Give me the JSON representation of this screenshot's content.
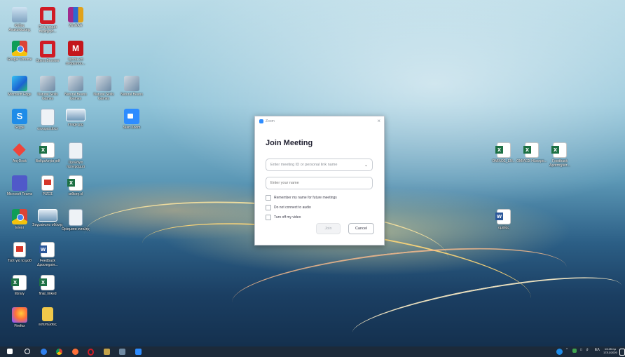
{
  "desktop": {
    "icons": [
      {
        "label": "Κάδος Ανακύκλωσης",
        "icon": "recycle-bin-icon"
      },
      {
        "label": "Πρόγραμμα περιήγησ...",
        "icon": "opera-icon"
      },
      {
        "label": "WinRAR",
        "icon": "winrar-icon"
      },
      {
        "label": "Google Chrome",
        "icon": "chrome-icon"
      },
      {
        "label": "Opera Browser",
        "icon": "opera-icon"
      },
      {
        "label": "Ιstoria και ανθρώπου...",
        "icon": "mcgraw-icon"
      },
      {
        "label": "Microsoft Edge",
        "icon": "edge-icon"
      },
      {
        "label": "Natural Skills Games",
        "icon": "boat-icon"
      },
      {
        "label": "Natural Beans Games",
        "icon": "boat-icon"
      },
      {
        "label": "Natural Skills Games",
        "icon": "boat-icon"
      },
      {
        "label": "Natural Beans",
        "icon": "boat-icon"
      },
      {
        "label": "Skype",
        "icon": "skype-icon"
      },
      {
        "label": "σεναρια.docx",
        "icon": "document-icon"
      },
      {
        "label": "image.jpg",
        "icon": "image-icon"
      },
      {
        "label": "Start Zoom",
        "icon": "zoom-icon"
      },
      {
        "label": "AnyDesk",
        "icon": "anydesk-icon"
      },
      {
        "label": "Βαθμολογία pdf",
        "icon": "excel-icon"
      },
      {
        "label": "Ωρολόγιο πρόγραμμα",
        "icon": "document-icon"
      },
      {
        "label": "Microsoft Teams",
        "icon": "teams-icon"
      },
      {
        "label": "ΡΙΖΟΣ",
        "icon": "pdf-icon"
      },
      {
        "label": "εκθεση.xl",
        "icon": "excel-icon"
      },
      {
        "label": "Ereni",
        "icon": "chrome-icon"
      },
      {
        "label": "Στιγμιότυπο οθόνης",
        "icon": "image-icon"
      },
      {
        "label": "Ορίσματα εντολής",
        "icon": "document-icon"
      },
      {
        "label": "Τεστ για τα μαθ",
        "icon": "pdf-icon"
      },
      {
        "label": "Feedback Δραστηριότ...",
        "icon": "word-icon"
      },
      {
        "label": "library",
        "icon": "excel-icon"
      },
      {
        "label": "final_linked",
        "icon": "excel-icon"
      },
      {
        "label": "Firefox",
        "icon": "firefox-icon"
      },
      {
        "label": "εκτυπώσεις",
        "icon": "folder-icon"
      },
      {
        "label": "ΟΜΙΛΟΣ_ΕΝ...",
        "icon": "excel-icon"
      },
      {
        "label": "ΟΜΙΛΟΣ Ηλεκτρο...",
        "icon": "excel-icon"
      },
      {
        "label": "Feedback Δραστηριότ...",
        "icon": "excel-icon"
      },
      {
        "label": "ομιλίας",
        "icon": "word-icon"
      }
    ]
  },
  "dialog": {
    "app_title": "Zoom",
    "close_glyph": "×",
    "heading": "Join Meeting",
    "meeting_id_placeholder": "Enter meeting ID or personal link name",
    "name_placeholder": "Enter your name",
    "options": [
      {
        "label": "Remember my name for future meetings",
        "checked": false
      },
      {
        "label": "Do not connect to audio",
        "checked": false
      },
      {
        "label": "Turn off my video",
        "checked": false
      }
    ],
    "join_label": "Join",
    "cancel_label": "Cancel"
  },
  "taskbar": {
    "language": "ΕΛ",
    "time": "13:45 πμ",
    "date": "17/11/2020"
  }
}
